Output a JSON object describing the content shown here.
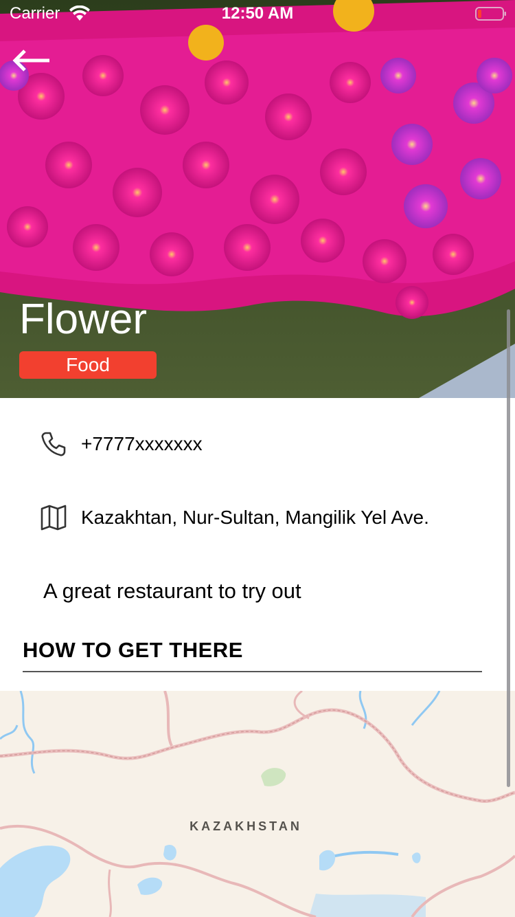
{
  "status_bar": {
    "carrier": "Carrier",
    "time": "12:50 AM"
  },
  "place": {
    "title": "Flower",
    "category": "Food",
    "phone": "+7777xxxxxxx",
    "address": "Kazakhtan, Nur-Sultan, Mangilik Yel Ave.",
    "description": "A great restaurant to try out"
  },
  "directions": {
    "header": "HOW TO GET THERE",
    "map_label": "KAZAKHSTAN"
  },
  "icons": {
    "back": "arrow-left-icon",
    "phone": "phone-icon",
    "address": "map-icon",
    "wifi": "wifi-icon",
    "battery": "battery-icon"
  },
  "colors": {
    "category_badge": "#f2402f",
    "map_land": "#f7f1e8",
    "map_water": "#b5dcf7",
    "map_border": "#e8b8b8"
  }
}
